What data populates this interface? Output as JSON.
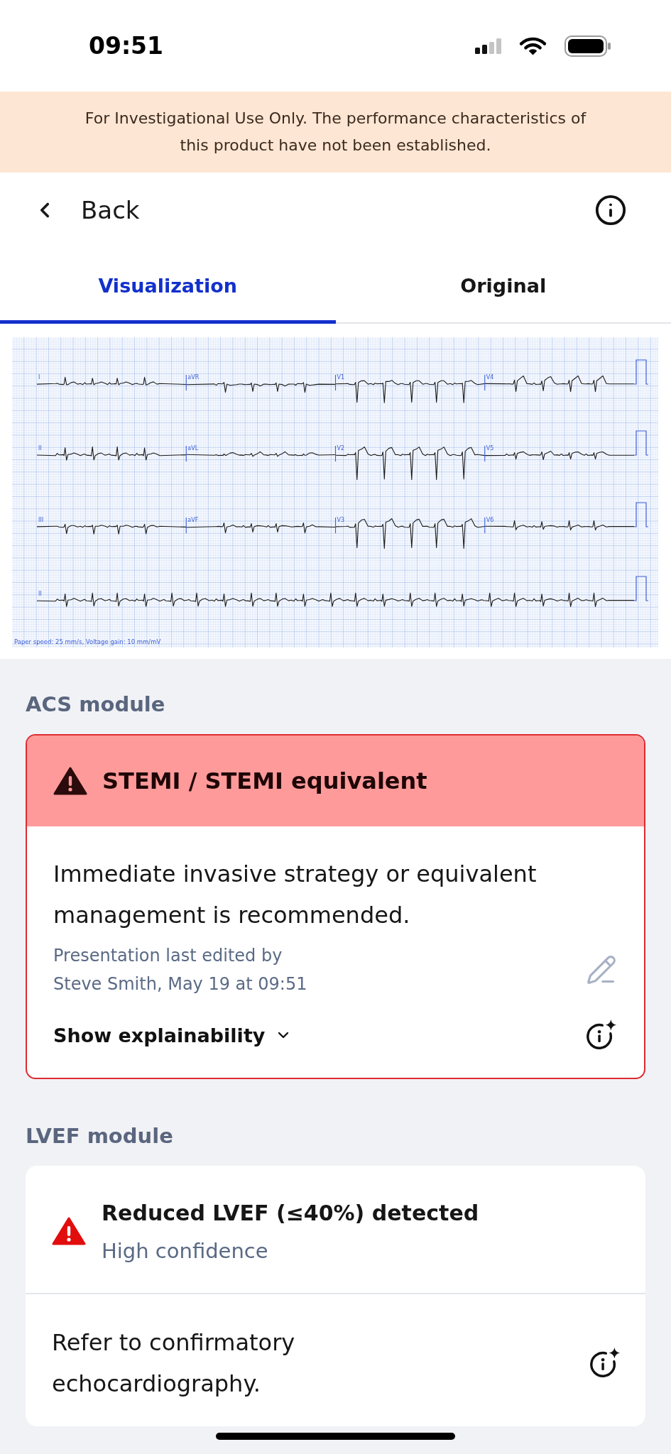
{
  "status_bar": {
    "time": "09:51"
  },
  "notice": "For Investigational Use Only. The performance characteristics of\nthis product have not been established.",
  "nav": {
    "back_label": "Back"
  },
  "tabs": [
    {
      "label": "Visualization",
      "selected": true
    },
    {
      "label": "Original",
      "selected": false
    }
  ],
  "ecg": {
    "rows": [
      {
        "leads": [
          "I",
          "aVR",
          "V1",
          "V4"
        ]
      },
      {
        "leads": [
          "II",
          "aVL",
          "V2",
          "V5"
        ]
      },
      {
        "leads": [
          "III",
          "aVF",
          "V3",
          "V6"
        ]
      },
      {
        "leads": [
          "II"
        ]
      }
    ],
    "scale_note": "Paper speed: 25 mm/s, Voltage gain: 10 mm/mV"
  },
  "modules": [
    {
      "heading": "ACS module",
      "kind": "banner",
      "title": "STEMI / STEMI equivalent",
      "recommendation": "Immediate invasive strategy or equivalent management is recommended.",
      "edit_note": "Presentation last edited by\nSteve Smith, May 19 at 09:51",
      "explain_label": "Show explainability",
      "expanded": false
    },
    {
      "heading": "LVEF module",
      "kind": "inline",
      "title": "Reduced LVEF (≤40%) detected",
      "confidence": "High confidence",
      "recommendation": "Refer to confirmatory echocardiography."
    }
  ]
}
